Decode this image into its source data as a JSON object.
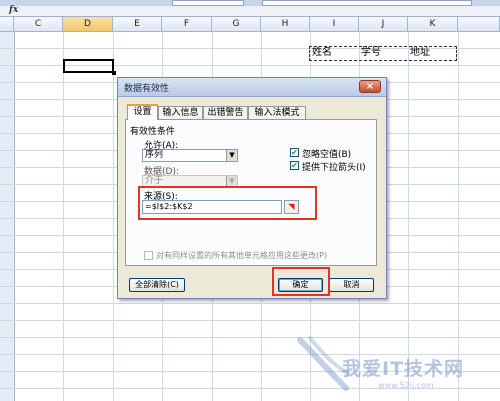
{
  "formula_bar": {
    "fx_label": "fx"
  },
  "columns": [
    "C",
    "D",
    "E",
    "F",
    "G",
    "H",
    "I",
    "J",
    "K"
  ],
  "active_column": "D",
  "sheet_cells": {
    "i": "姓名",
    "j": "学号",
    "k": "地址"
  },
  "dialog": {
    "title": "数据有效性",
    "close_glyph": "×",
    "tabs": [
      "设置",
      "输入信息",
      "出错警告",
      "输入法模式"
    ],
    "section_title": "有效性条件",
    "allow_label": "允许(A):",
    "allow_value": "序列",
    "data_label": "数据(D):",
    "data_value": "介于",
    "ignore_blank_label": "忽略空值(B)",
    "ignore_blank_checked": true,
    "dropdown_label": "提供下拉箭头(I)",
    "dropdown_checked": true,
    "source_label": "来源(S):",
    "source_value": "=$I$2:$K$2",
    "apply_all_label": "对有同样设置的所有其他单元格应用这些更改(P)",
    "clear_all_label": "全部清除(C)",
    "ok_label": "确定",
    "cancel_label": "取消"
  },
  "watermark": {
    "text": "我爱IT技术网",
    "url": "www.52ij.com"
  },
  "colors": {
    "highlight_red": "#e0332a",
    "check_green": "#21a121",
    "dialog_bg": "#ece9d8"
  }
}
